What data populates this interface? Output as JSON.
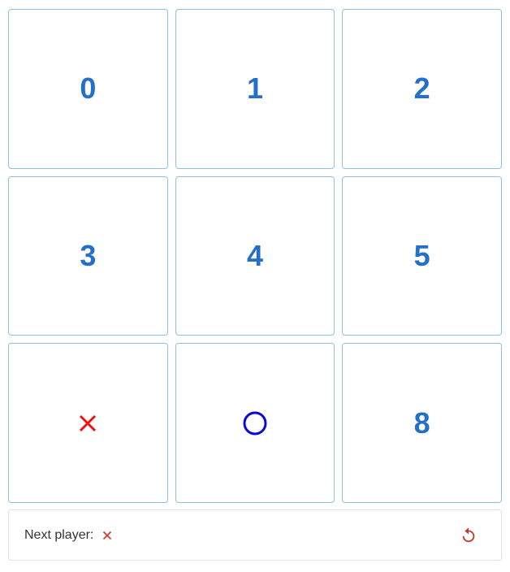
{
  "board": {
    "cells": [
      {
        "index": 0,
        "state": "empty",
        "label": "0"
      },
      {
        "index": 1,
        "state": "empty",
        "label": "1"
      },
      {
        "index": 2,
        "state": "empty",
        "label": "2"
      },
      {
        "index": 3,
        "state": "empty",
        "label": "3"
      },
      {
        "index": 4,
        "state": "empty",
        "label": "4"
      },
      {
        "index": 5,
        "state": "empty",
        "label": "5"
      },
      {
        "index": 6,
        "state": "x",
        "label": ""
      },
      {
        "index": 7,
        "state": "o",
        "label": ""
      },
      {
        "index": 8,
        "state": "empty",
        "label": "8"
      }
    ]
  },
  "status": {
    "label": "Next player:",
    "next_player": "x"
  },
  "icons": {
    "x_mark": "x-mark-icon",
    "o_mark": "o-mark-icon",
    "restart": "restart-icon"
  },
  "colors": {
    "number": "#2470c8",
    "x_mark": "#ee1111",
    "o_mark": "#0a0ad8",
    "cell_border": "#8fc0e0",
    "restart": "#c0392b"
  }
}
